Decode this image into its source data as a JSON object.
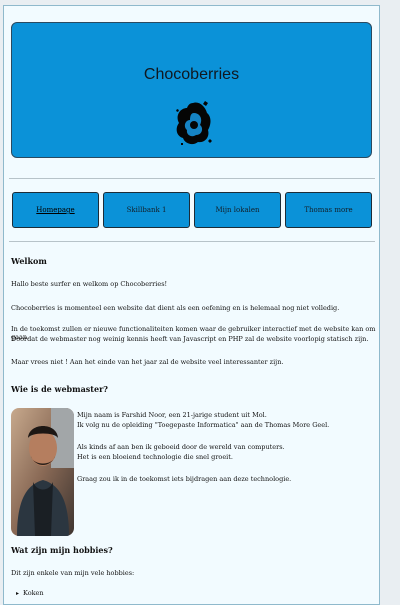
{
  "header": {
    "title": "Chocoberries",
    "logo_icon": "splash-logo-icon",
    "bg_color": "#0b92d8"
  },
  "nav": {
    "items": [
      {
        "label": "Homepage",
        "active": true
      },
      {
        "label": "Skillbank 1"
      },
      {
        "label": "Mijn lokalen"
      },
      {
        "label": "Thomas more"
      }
    ]
  },
  "intro": {
    "heading": "Welkom",
    "lines": [
      "Hallo beste surfer en welkom op Chocoberries!",
      "Chocoberries is momenteel een website dat dient als een oefening en is helemaal nog niet volledig.",
      "In de toekomst zullen er nieuwe functionaliteiten komen waar de gebruiker interactief met de website kan om gaan.",
      "Doordat de webmaster nog weinig kennis heeft van Javascript en PHP zal de website voorlopig statisch zijn.",
      "Maar vrees niet ! Aan het einde van het jaar zal de website veel interessanter zijn."
    ]
  },
  "webmaster": {
    "heading": "Wie is de webmaster?",
    "lines": [
      "Mijn naam is Farshid Noor, een 21-jarige student uit Mol.",
      "Ik volg nu de opleiding \"Toegepaste Informatica\" aan de Thomas More Geel.",
      "Als kinds af aan ben ik geboeid door de wereld van computers.",
      "Het is een bloeiend technologie die snel groeit.",
      "Graag zou ik in de toekomst iets bijdragen aan deze technologie."
    ]
  },
  "hobbies": {
    "heading": "Wat zijn mijn hobbies?",
    "intro": "Dit zijn enkele van mijn vele hobbies:",
    "items": [
      "Koken"
    ]
  }
}
